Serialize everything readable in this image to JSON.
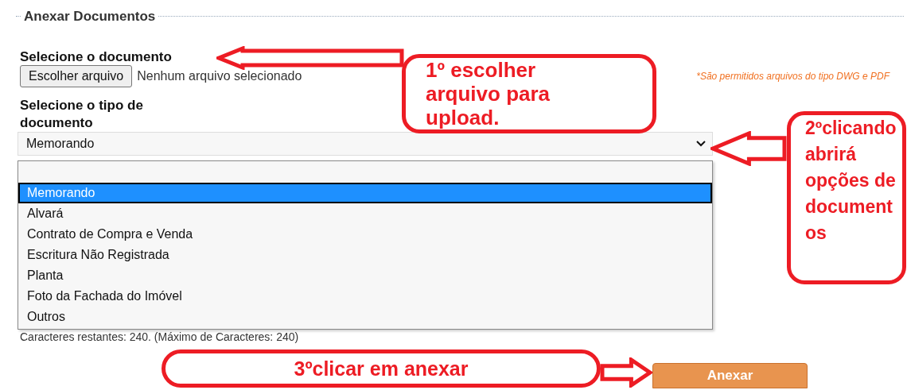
{
  "fieldset": {
    "legend": "Anexar Documentos"
  },
  "file_field": {
    "label": "Selecione o documento",
    "button": "Escolher arquivo",
    "status": "Nenhum arquivo selecionado",
    "note": "*São permitidos arquivos do tipo DWG e PDF"
  },
  "type_select": {
    "label": "Selecione o tipo de documento",
    "value": "Memorando",
    "expanded": true,
    "options": [
      {
        "label": "Memorando",
        "selected": true
      },
      {
        "label": "Alvará",
        "selected": false
      },
      {
        "label": "Contrato de Compra e Venda",
        "selected": false
      },
      {
        "label": "Escritura Não Registrada",
        "selected": false
      },
      {
        "label": "Planta",
        "selected": false
      },
      {
        "label": "Foto da Fachada do Imóvel",
        "selected": false
      },
      {
        "label": "Outros",
        "selected": false
      }
    ]
  },
  "char_counter": "Caracteres restantes: 240. (Máximo de Caracteres: 240)",
  "submit_button": "Anexar",
  "annotations": {
    "step1": "1º escolher arquivo para upload.",
    "step2": "2ºclicando abrirá opções de documentos",
    "step3": "3ºclicar em anexar"
  }
}
